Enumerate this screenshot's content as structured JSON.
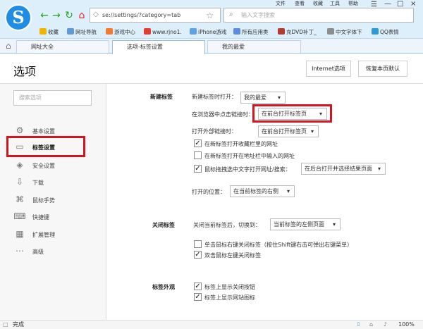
{
  "browser": {
    "logo": "S",
    "address": "se://settings/?category=tab",
    "search_placeholder": "输入文字搜索",
    "menu": [
      "文件",
      "查看",
      "收藏",
      "工具",
      "帮助"
    ],
    "bookmarks": [
      {
        "label": "收藏",
        "color": "#f0b400"
      },
      {
        "label": "网址导航",
        "color": "#5f99d6"
      },
      {
        "label": "游戏中心",
        "color": "#f27b31"
      },
      {
        "label": "www.rjno1.",
        "color": "#e23d31"
      },
      {
        "label": "iPhone游戏",
        "color": "#5ea2e8"
      },
      {
        "label": "所有应用类",
        "color": "#5b8de3"
      },
      {
        "label": "充DVD补丁_",
        "color": "#b33b2e"
      },
      {
        "label": "中文字体下",
        "color": "#8c8c8c"
      },
      {
        "label": "QQ表情",
        "color": "#2f9bd5"
      }
    ],
    "tabs": [
      {
        "label": "网址大全"
      },
      {
        "label": "选项-标签设置"
      },
      {
        "label": "我的最爱"
      }
    ]
  },
  "page": {
    "title": "选项",
    "internet_options": "Internet选项",
    "restore_default": "恢复本页默认",
    "filter_placeholder": "搜索选项"
  },
  "sidebar": [
    {
      "label": "基本设置",
      "icon": "gear-icon"
    },
    {
      "label": "标签设置",
      "icon": "tab-icon"
    },
    {
      "label": "安全设置",
      "icon": "shield-icon"
    },
    {
      "label": "下载",
      "icon": "download-icon"
    },
    {
      "label": "鼠标手势",
      "icon": "gesture-icon"
    },
    {
      "label": "快捷键",
      "icon": "keyboard-icon"
    },
    {
      "label": "扩展管理",
      "icon": "extension-icon"
    },
    {
      "label": "高级",
      "icon": "advanced-icon"
    }
  ],
  "new_tab": {
    "title": "新建标签",
    "open_when_new": "新建标签时打开：",
    "open_when_new_value": "我的最爱",
    "browser_link": "在浏览器中点击链接时：",
    "browser_link_value": "在前台打开标签页",
    "external_link": "打开外部链接时：",
    "external_link_value": "在前台打开标签页",
    "checks": [
      {
        "label": "在新标签打开收藏栏里的网址",
        "checked": true
      },
      {
        "label": "在新标签打开在地址栏中输入的网址",
        "checked": false
      },
      {
        "label": "鼠标拖拽选中文字打开网址/搜索：",
        "checked": true
      }
    ],
    "drag_value": "在后台打开并选择结果页面",
    "position": "打开的位置：",
    "position_value": "在当前标签的右侧"
  },
  "close_tab": {
    "title": "关闭标签",
    "after_close": "关闭当前标签后，切换到：",
    "after_close_value": "当前标签的左侧页面",
    "checks": [
      {
        "label": "单击鼠标右键关闭标签（按住Shift键右击可弹出右键菜单）",
        "checked": false
      },
      {
        "label": "双击鼠标左键关闭标签",
        "checked": true
      }
    ]
  },
  "appearance": {
    "title": "标签外观",
    "checks": [
      {
        "label": "标签上显示关闭按钮",
        "checked": true
      },
      {
        "label": "标签上显示网站图标",
        "checked": true
      }
    ]
  },
  "status": {
    "ready": "完成",
    "zoom": "100%"
  }
}
